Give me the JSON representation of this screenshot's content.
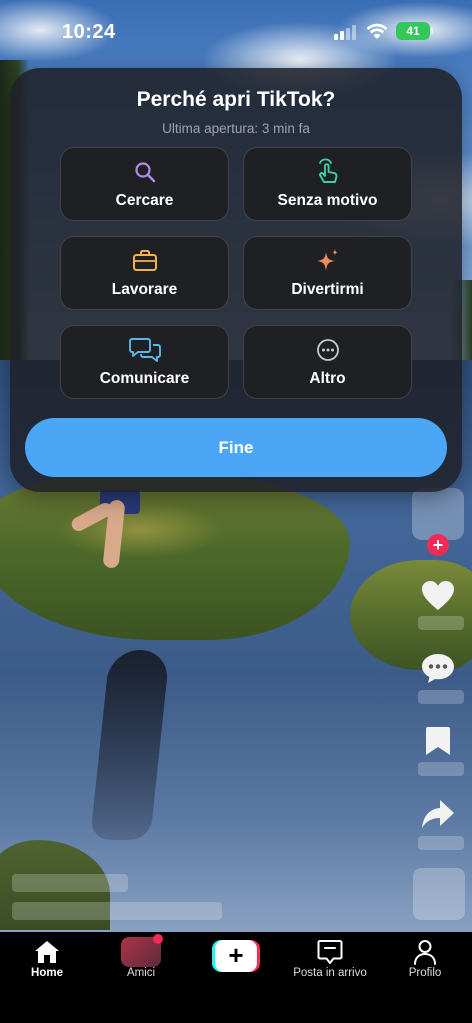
{
  "status_bar": {
    "time": "10:24",
    "battery": "41",
    "icons": [
      "cellular-signal-icon",
      "wifi-icon",
      "battery-icon"
    ]
  },
  "popup": {
    "title": "Perché apri TikTok?",
    "subtitle": "Ultima apertura: 3 min fa",
    "options": [
      {
        "label": "Cercare",
        "icon": "search-icon",
        "color": "#b28be8"
      },
      {
        "label": "Senza motivo",
        "icon": "tap-hand-icon",
        "color": "#3ecf9c"
      },
      {
        "label": "Lavorare",
        "icon": "briefcase-icon",
        "color": "#f2b24c"
      },
      {
        "label": "Divertirmi",
        "icon": "sparkles-icon",
        "color": "#f08a5d"
      },
      {
        "label": "Comunicare",
        "icon": "chat-bubbles-icon",
        "color": "#5cb6e8"
      },
      {
        "label": "Altro",
        "icon": "more-dots-icon",
        "color": "#c9c9cf"
      }
    ],
    "confirm_label": "Fine",
    "confirm_color": "#4ba6f5"
  },
  "right_rail": {
    "icons": [
      "creator-avatar",
      "follow-plus-icon",
      "heart-icon",
      "comment-icon",
      "bookmark-icon",
      "share-icon",
      "music-disc"
    ]
  },
  "bottom_nav": {
    "items": [
      {
        "label": "Home",
        "icon": "home-icon",
        "active": true
      },
      {
        "label": "Amici",
        "icon": "friends-icon",
        "active": false
      },
      {
        "label": "",
        "icon": "create-plus-icon",
        "active": false
      },
      {
        "label": "Posta in arrivo",
        "icon": "inbox-icon",
        "active": false
      },
      {
        "label": "Profilo",
        "icon": "profile-icon",
        "active": false
      }
    ]
  },
  "colors": {
    "accent": "#4ba6f5",
    "battery_green": "#34c759",
    "notification_red": "#ee2a55"
  }
}
